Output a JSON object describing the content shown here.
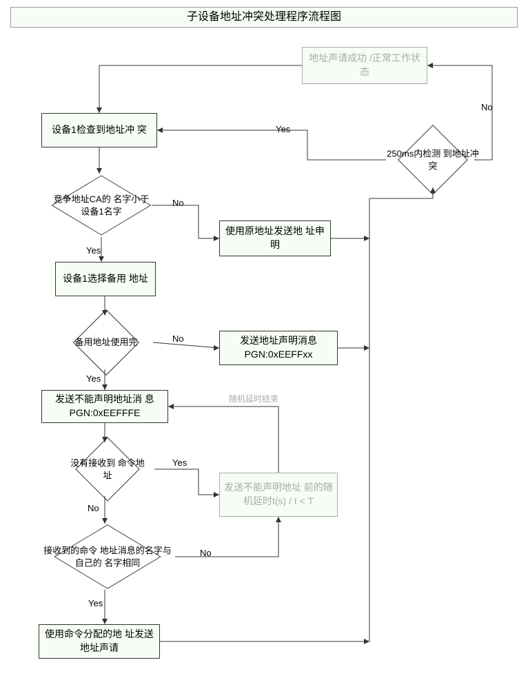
{
  "title": "子设备地址冲突处理程序流程图",
  "nodes": {
    "start": "地址声请成功\n/正常工作状态",
    "detect_conflict": "设备1检查到地址冲\n突",
    "name_less": "竞争地址CA的\n名字小于设备1名字",
    "select_backup": "设备1选择备用\n地址",
    "backup_used": "备用地址使用完",
    "cannot_claim": "发送不能声明地址消\n息PGN:0xEEFFFE",
    "no_cmd_addr": "没有接收到\n命令地址",
    "name_same": "接收到的命令\n地址消息的名字与自己的\n名字相同",
    "use_cmd_addr": "使用命令分配的地\n址发送地址声请",
    "send_orig": "使用原地址发送地\n址申明",
    "send_claim_pgn": "发送地址声明消息\nPGN:0xEEFFxx",
    "random_delay": "发送不能声明地址\n前的随机延时t(s) /\nt < T",
    "conflict_250ms": "250ms内检测\n到地址冲突"
  },
  "labels": {
    "yes": "Yes",
    "no": "No",
    "delay_end": "随机延时结束"
  }
}
